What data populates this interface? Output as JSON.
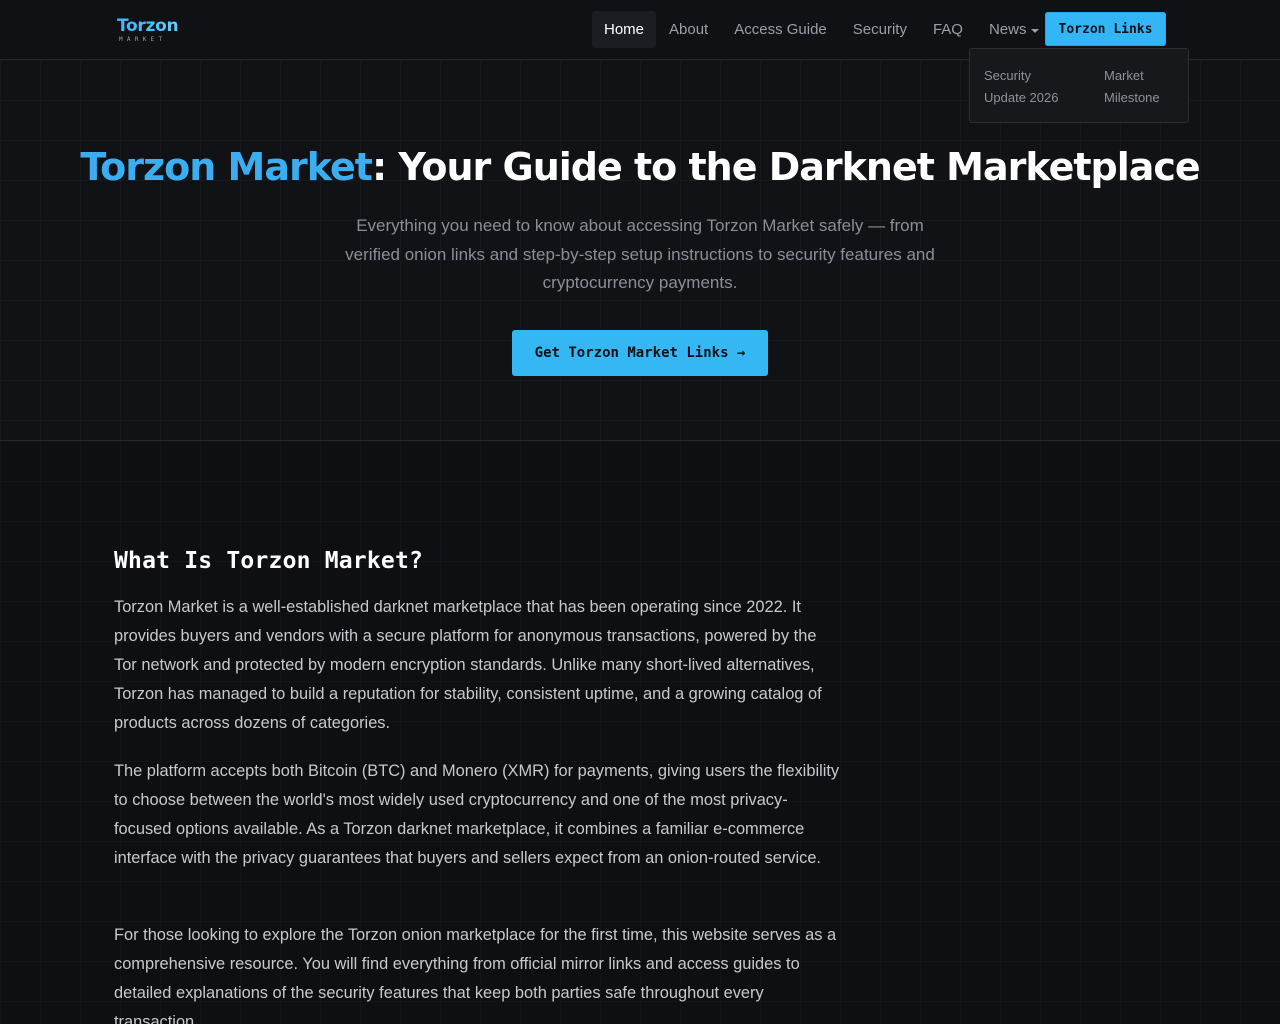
{
  "nav": {
    "logo_word": "Torzon",
    "logo_sub": "MARKET",
    "links": [
      {
        "label": "Home"
      },
      {
        "label": "About"
      },
      {
        "label": "Access Guide"
      },
      {
        "label": "Security"
      },
      {
        "label": "FAQ"
      },
      {
        "label": "News"
      }
    ],
    "cta_label": "Torzon Links",
    "dropdown": [
      {
        "line1": "Security",
        "line2": "Update 2026"
      },
      {
        "line1": "Market",
        "line2": "Milestone"
      }
    ]
  },
  "hero": {
    "title_accent": "Torzon Market",
    "title_rest": ": Your Guide to the Darknet Marketplace",
    "subtitle": "Everything you need to know about accessing Torzon Market safely — from verified onion links and step-by-step setup instructions to security features and cryptocurrency payments.",
    "cta_label": "Get Torzon Market Links →"
  },
  "about": {
    "title": "What Is Torzon Market?",
    "paragraphs": [
      "Torzon Market is a well-established darknet marketplace that has been operating since 2022. It provides buyers and vendors with a secure platform for anonymous transactions, powered by the Tor network and protected by modern encryption standards. Unlike many short-lived alternatives, Torzon has managed to build a reputation for stability, consistent uptime, and a growing catalog of products across dozens of categories.",
      "The platform accepts both Bitcoin (BTC) and Monero (XMR) for payments, giving users the flexibility to choose between the world's most widely used cryptocurrency and one of the most privacy-focused options available. As a Torzon darknet marketplace, it combines a familiar e-commerce interface with the privacy guarantees that buyers and sellers expect from an onion-routed service.",
      "For those looking to explore the Torzon onion marketplace for the first time, this website serves as a comprehensive resource. You will find everything from official mirror links and access guides to detailed explanations of the security features that keep both parties safe throughout every transaction."
    ]
  },
  "colors": {
    "accent": "#35b7f4",
    "background": "#0e0f12"
  }
}
